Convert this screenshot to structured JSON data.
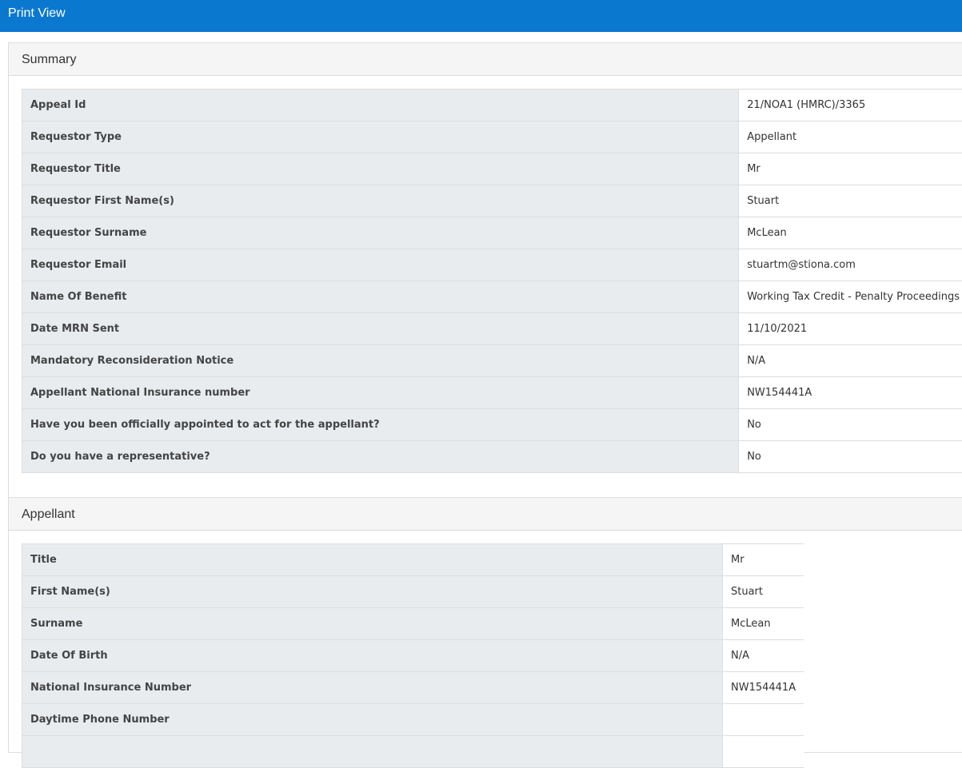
{
  "topbar": {
    "title": "Print View"
  },
  "summary": {
    "heading": "Summary",
    "rows": [
      {
        "label": "Appeal Id",
        "value": "21/NOA1 (HMRC)/3365"
      },
      {
        "label": "Requestor Type",
        "value": "Appellant"
      },
      {
        "label": "Requestor Title",
        "value": "Mr"
      },
      {
        "label": "Requestor First Name(s)",
        "value": "Stuart"
      },
      {
        "label": "Requestor Surname",
        "value": "McLean"
      },
      {
        "label": "Requestor Email",
        "value": "stuartm@stiona.com"
      },
      {
        "label": "Name Of Benefit",
        "value": "Working Tax Credit - Penalty Proceedings"
      },
      {
        "label": "Date MRN Sent",
        "value": "11/10/2021"
      },
      {
        "label": "Mandatory Reconsideration Notice",
        "value": "N/A"
      },
      {
        "label": "Appellant National Insurance number",
        "value": "NW154441A"
      },
      {
        "label": "Have you been officially appointed to act for the appellant?",
        "value": "No"
      },
      {
        "label": "Do you have a representative?",
        "value": "No"
      }
    ]
  },
  "appellant": {
    "heading": "Appellant",
    "rows": [
      {
        "label": "Title",
        "value": "Mr"
      },
      {
        "label": "First Name(s)",
        "value": "Stuart"
      },
      {
        "label": "Surname",
        "value": "McLean"
      },
      {
        "label": "Date Of Birth",
        "value": "N/A"
      },
      {
        "label": "National Insurance Number",
        "value": "NW154441A"
      },
      {
        "label": "Daytime Phone Number",
        "value": ""
      },
      {
        "label": "",
        "value": ""
      }
    ]
  }
}
